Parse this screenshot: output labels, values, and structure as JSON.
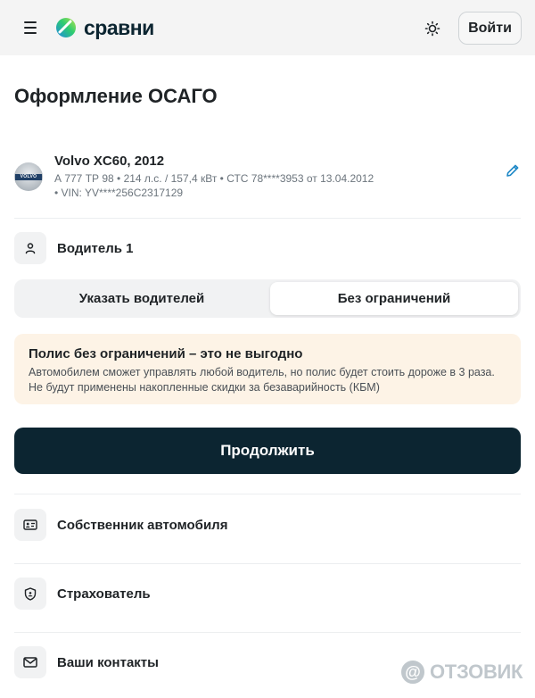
{
  "header": {
    "logo_text": "сравни",
    "login_label": "Войти"
  },
  "page": {
    "title": "Оформление ОСАГО"
  },
  "car": {
    "logo_text": "VOLVO",
    "name": "Volvo XC60, 2012",
    "details": "А 777 ТР 98 • 214 л.с. / 157,4 кВт • СТС 78****3953 от 13.04.2012",
    "vin": "• VIN: YV****256C2317129"
  },
  "driver": {
    "label": "Водитель 1"
  },
  "driver_mode": {
    "options": [
      "Указать водителей",
      "Без ограничений"
    ],
    "selected": "Без ограничений"
  },
  "warning": {
    "title": "Полис без ограничений – это не выгодно",
    "line1": "Автомобилем сможет управлять любой водитель, но полис будет стоить дороже в 3 раза.",
    "line2": "Не будут применены накопленные скидки за безаварийность (КБМ)"
  },
  "actions": {
    "continue_label": "Продолжить"
  },
  "sections": [
    {
      "label": "Собственник автомобиля",
      "icon": "id-card-icon"
    },
    {
      "label": "Страхователь",
      "icon": "shield-icon"
    },
    {
      "label": "Ваши контакты",
      "icon": "mail-icon"
    }
  ],
  "watermark": {
    "symbol": "@",
    "text": "ОТЗОВИК"
  },
  "colors": {
    "primary_dark": "#0c2531",
    "warning_bg": "#fdf3e6",
    "accent_blue": "#1e88c7",
    "logo_green": "#2ecc71"
  }
}
